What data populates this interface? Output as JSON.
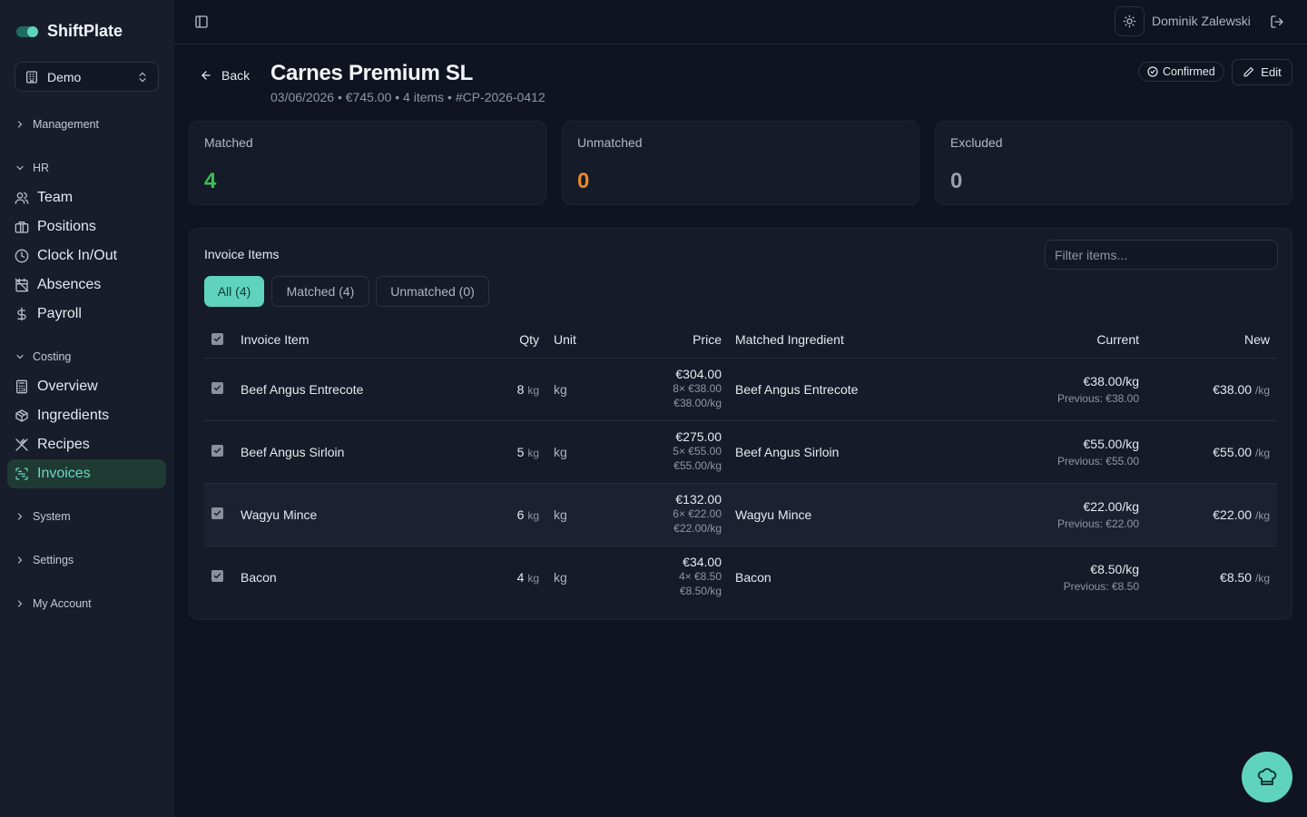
{
  "app": {
    "name": "ShiftPlate"
  },
  "org_select": {
    "label": "Demo"
  },
  "sidebar": {
    "sections": [
      {
        "label": "Management"
      },
      {
        "label": "HR"
      },
      {
        "label": "Costing"
      },
      {
        "label": "System"
      },
      {
        "label": "Settings"
      },
      {
        "label": "My Account"
      }
    ],
    "items": [
      {
        "label": "Team",
        "icon": "users-icon"
      },
      {
        "label": "Positions",
        "icon": "briefcase-icon"
      },
      {
        "label": "Clock In/Out",
        "icon": "clock-icon"
      },
      {
        "label": "Absences",
        "icon": "calendar-off-icon"
      },
      {
        "label": "Payroll",
        "icon": "dollar-icon"
      },
      {
        "label": "Overview",
        "icon": "calculator-icon"
      },
      {
        "label": "Ingredients",
        "icon": "package-icon"
      },
      {
        "label": "Recipes",
        "icon": "utensils-icon"
      },
      {
        "label": "Invoices",
        "icon": "scan-icon",
        "active": true
      }
    ]
  },
  "topbar": {
    "user_name": "Dominik Zalewski"
  },
  "header": {
    "back_label": "Back",
    "title": "Carnes Premium SL",
    "meta": "03/06/2026 • €745.00 • 4 items • #CP-2026-0412",
    "status": "Confirmed",
    "edit_label": "Edit"
  },
  "stats": [
    {
      "label": "Matched",
      "value": "4",
      "color": "#3fbf4f"
    },
    {
      "label": "Unmatched",
      "value": "0",
      "color": "#e8872b"
    },
    {
      "label": "Excluded",
      "value": "0",
      "color": "#9aa1ad"
    }
  ],
  "items_panel": {
    "title": "Invoice Items",
    "filter_placeholder": "Filter items...",
    "tabs": [
      {
        "label": "All (4)",
        "active": true
      },
      {
        "label": "Matched (4)"
      },
      {
        "label": "Unmatched (0)"
      }
    ],
    "columns": {
      "item": "Invoice Item",
      "qty": "Qty",
      "unit": "Unit",
      "price": "Price",
      "matched": "Matched Ingredient",
      "current": "Current",
      "new": "New"
    },
    "rows": [
      {
        "name": "Beef Angus Entrecote",
        "qty": "8",
        "qty_unit": "kg",
        "unit": "kg",
        "total": "€304.00",
        "calc": "8× €38.00",
        "unit_price": "€38.00/kg",
        "matched": "Beef Angus Entrecote",
        "current": "€38.00/kg",
        "previous": "Previous: €38.00",
        "new_price": "€38.00",
        "new_unit": "/kg"
      },
      {
        "name": "Beef Angus Sirloin",
        "qty": "5",
        "qty_unit": "kg",
        "unit": "kg",
        "total": "€275.00",
        "calc": "5× €55.00",
        "unit_price": "€55.00/kg",
        "matched": "Beef Angus Sirloin",
        "current": "€55.00/kg",
        "previous": "Previous: €55.00",
        "new_price": "€55.00",
        "new_unit": "/kg"
      },
      {
        "name": "Wagyu Mince",
        "qty": "6",
        "qty_unit": "kg",
        "unit": "kg",
        "total": "€132.00",
        "calc": "6× €22.00",
        "unit_price": "€22.00/kg",
        "matched": "Wagyu Mince",
        "current": "€22.00/kg",
        "previous": "Previous: €22.00",
        "new_price": "€22.00",
        "new_unit": "/kg"
      },
      {
        "name": "Bacon",
        "qty": "4",
        "qty_unit": "kg",
        "unit": "kg",
        "total": "€34.00",
        "calc": "4× €8.50",
        "unit_price": "€8.50/kg",
        "matched": "Bacon",
        "current": "€8.50/kg",
        "previous": "Previous: €8.50",
        "new_price": "€8.50",
        "new_unit": "/kg"
      }
    ]
  },
  "fab": {
    "icon": "chef-hat-icon"
  }
}
